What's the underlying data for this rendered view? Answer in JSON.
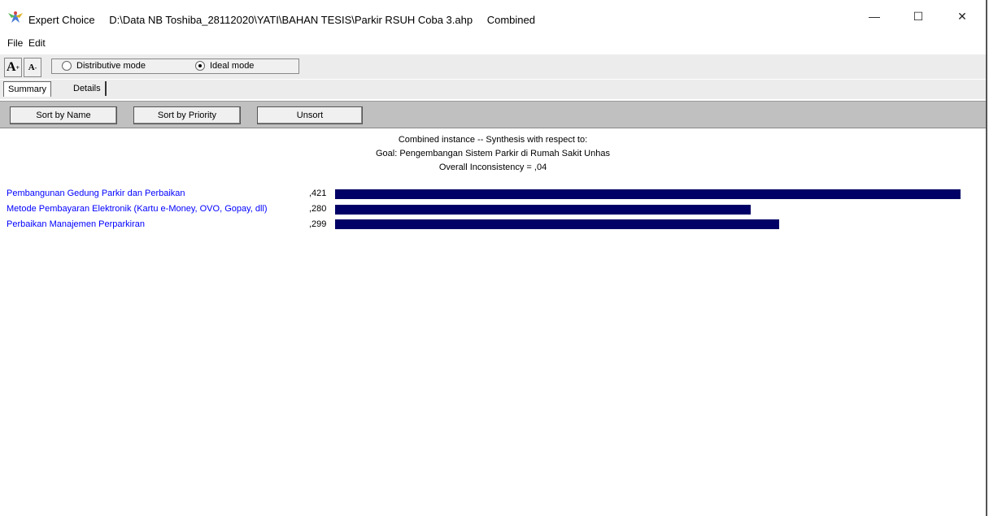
{
  "window": {
    "app_name": "Expert Choice",
    "file_path": "D:\\Data NB Toshiba_28112020\\YATI\\BAHAN TESIS\\Parkir RSUH Coba 3.ahp",
    "mode_label": "Combined",
    "minimize": "—",
    "maximize": "☐",
    "close": "✕"
  },
  "menu": {
    "file": "File",
    "edit": "Edit"
  },
  "toolbar": {
    "font_increase": "A",
    "font_decrease": "A",
    "modes": [
      {
        "label": "Distributive mode",
        "selected": false
      },
      {
        "label": "Ideal mode",
        "selected": true
      }
    ]
  },
  "tabs": [
    {
      "label": "Summary",
      "active": true
    },
    {
      "label": "Details",
      "active": false
    }
  ],
  "sort_buttons": {
    "by_name": "Sort by Name",
    "by_priority": "Sort by Priority",
    "unsort": "Unsort"
  },
  "synthesis": {
    "line1": "Combined instance -- Synthesis with respect to:",
    "line2": "Goal: Pengembangan Sistem Parkir di Rumah Sakit Unhas",
    "line3": "Overall Inconsistency = ,04"
  },
  "chart_data": {
    "type": "bar",
    "categories": [
      "Pembangunan Gedung Parkir dan Perbaikan",
      "Metode Pembayaran Elektronik (Kartu e-Money, OVO, Gopay, dll)",
      "Perbaikan Manajemen Perparkiran"
    ],
    "values": [
      0.421,
      0.28,
      0.299
    ],
    "value_labels": [
      ",421",
      ",280",
      ",299"
    ],
    "bar_color": "#000066",
    "label_color": "#0000ff"
  }
}
